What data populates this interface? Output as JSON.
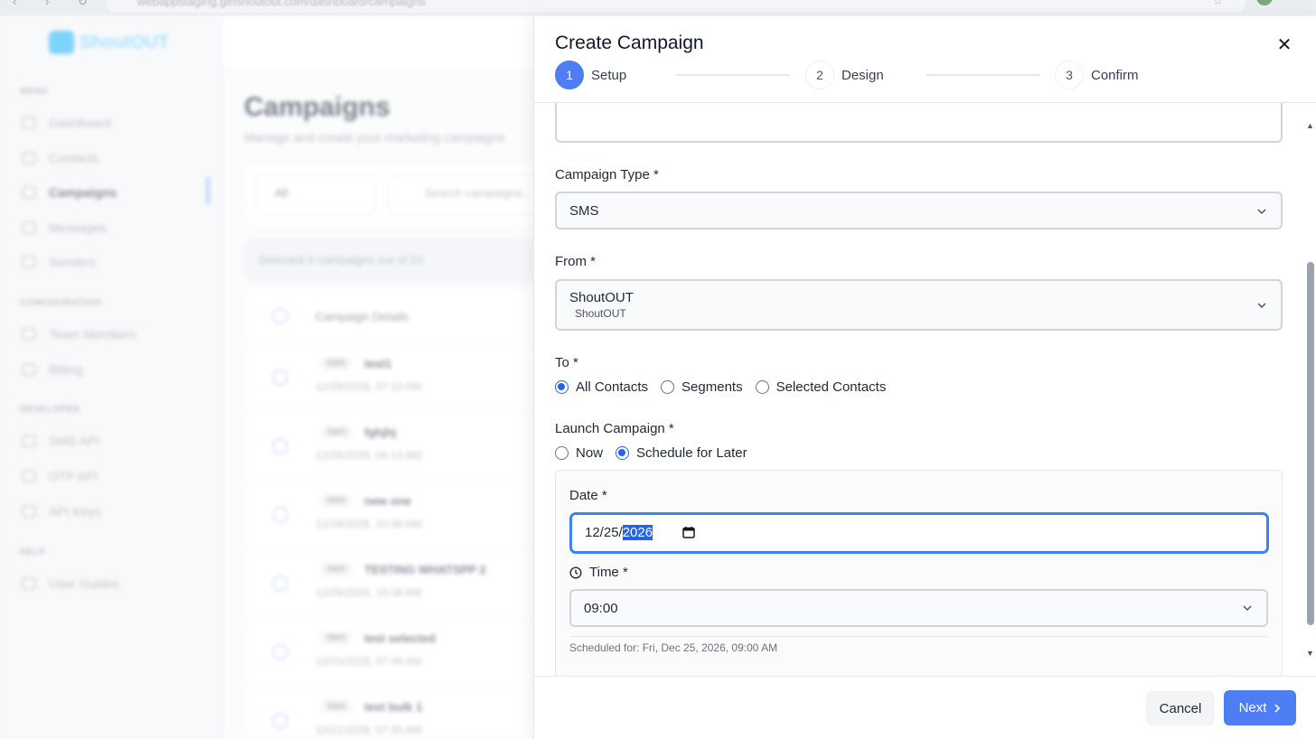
{
  "browser": {
    "url": "webappstaging.getshoutout.com/dashboard/campaigns"
  },
  "background": {
    "logo_text": "ShoutOUT",
    "sections": [
      "MENU",
      "CONFIGURATION",
      "DEVELOPER",
      "HELP"
    ],
    "nav_items": [
      {
        "label": "Dashboard",
        "icon": "grid-icon"
      },
      {
        "label": "Contacts",
        "icon": "person-icon"
      },
      {
        "label": "Campaigns",
        "icon": "campaign-icon"
      },
      {
        "label": "Messages",
        "icon": "message-icon"
      },
      {
        "label": "Senders",
        "icon": "person-icon"
      },
      {
        "label": "Team Members",
        "icon": "team-icon"
      },
      {
        "label": "Billing",
        "icon": "billing-icon"
      },
      {
        "label": "SMS API",
        "icon": "link-icon"
      },
      {
        "label": "OTP API",
        "icon": "otp-icon"
      },
      {
        "label": "API Keys",
        "icon": "key-icon"
      },
      {
        "label": "User Guides",
        "icon": "guide-icon"
      }
    ],
    "page_title": "Campaigns",
    "page_subtitle": "Manage and create your marketing campaigns",
    "filter_label": "All",
    "search_placeholder": "Search campaigns...",
    "selected_text": "Selected  0  campaigns out of 23",
    "table_header": "Campaign Details",
    "rows": [
      {
        "badge": "SMS",
        "name": "test1",
        "date": "12/26/2026, 07:10 AM"
      },
      {
        "badge": "SMS",
        "name": "fghjhj",
        "date": "12/26/2026, 04:13 AM"
      },
      {
        "badge": "SMS",
        "name": "new one",
        "date": "12/26/2026, 10:38 AM"
      },
      {
        "badge": "SMS",
        "name": "TESTING WHATSPP 2",
        "date": "12/26/2026, 10:38 AM"
      },
      {
        "badge": "SMS",
        "name": "test selected",
        "date": "12/21/2026, 07:49 AM"
      },
      {
        "badge": "SMS",
        "name": "test bulk 1",
        "date": "12/21/2026, 07:35 AM"
      }
    ]
  },
  "drawer": {
    "title": "Create Campaign",
    "steps": [
      {
        "num": "1",
        "label": "Setup"
      },
      {
        "num": "2",
        "label": "Design"
      },
      {
        "num": "3",
        "label": "Confirm"
      }
    ],
    "campaign_type": {
      "label": "Campaign Type *",
      "value": "SMS"
    },
    "from": {
      "label": "From *",
      "value": "ShoutOUT",
      "sub": "ShoutOUT"
    },
    "to": {
      "label": "To *",
      "options": [
        "All Contacts",
        "Segments",
        "Selected Contacts"
      ],
      "selected": "All Contacts"
    },
    "launch": {
      "label": "Launch Campaign *",
      "options": [
        "Now",
        "Schedule for Later"
      ],
      "selected": "Schedule for Later"
    },
    "date": {
      "label": "Date *",
      "month_day": "12/25/",
      "year": "2026"
    },
    "time": {
      "label": "Time *",
      "value": "09:00"
    },
    "scheduled_text": "Scheduled for: Fri, Dec 25, 2026, 09:00 AM",
    "cancel_label": "Cancel",
    "next_label": "Next"
  },
  "colors": {
    "primary": "#4f7df3",
    "focus": "#3b82f6"
  }
}
